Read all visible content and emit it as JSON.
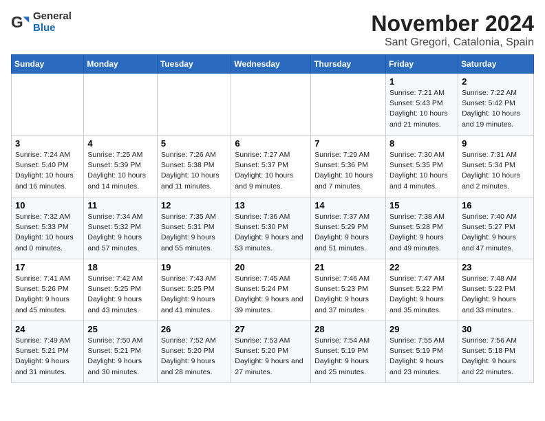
{
  "header": {
    "logo_general": "General",
    "logo_blue": "Blue",
    "month": "November 2024",
    "location": "Sant Gregori, Catalonia, Spain"
  },
  "weekdays": [
    "Sunday",
    "Monday",
    "Tuesday",
    "Wednesday",
    "Thursday",
    "Friday",
    "Saturday"
  ],
  "weeks": [
    [
      {
        "day": "",
        "info": ""
      },
      {
        "day": "",
        "info": ""
      },
      {
        "day": "",
        "info": ""
      },
      {
        "day": "",
        "info": ""
      },
      {
        "day": "",
        "info": ""
      },
      {
        "day": "1",
        "info": "Sunrise: 7:21 AM\nSunset: 5:43 PM\nDaylight: 10 hours and 21 minutes."
      },
      {
        "day": "2",
        "info": "Sunrise: 7:22 AM\nSunset: 5:42 PM\nDaylight: 10 hours and 19 minutes."
      }
    ],
    [
      {
        "day": "3",
        "info": "Sunrise: 7:24 AM\nSunset: 5:40 PM\nDaylight: 10 hours and 16 minutes."
      },
      {
        "day": "4",
        "info": "Sunrise: 7:25 AM\nSunset: 5:39 PM\nDaylight: 10 hours and 14 minutes."
      },
      {
        "day": "5",
        "info": "Sunrise: 7:26 AM\nSunset: 5:38 PM\nDaylight: 10 hours and 11 minutes."
      },
      {
        "day": "6",
        "info": "Sunrise: 7:27 AM\nSunset: 5:37 PM\nDaylight: 10 hours and 9 minutes."
      },
      {
        "day": "7",
        "info": "Sunrise: 7:29 AM\nSunset: 5:36 PM\nDaylight: 10 hours and 7 minutes."
      },
      {
        "day": "8",
        "info": "Sunrise: 7:30 AM\nSunset: 5:35 PM\nDaylight: 10 hours and 4 minutes."
      },
      {
        "day": "9",
        "info": "Sunrise: 7:31 AM\nSunset: 5:34 PM\nDaylight: 10 hours and 2 minutes."
      }
    ],
    [
      {
        "day": "10",
        "info": "Sunrise: 7:32 AM\nSunset: 5:33 PM\nDaylight: 10 hours and 0 minutes."
      },
      {
        "day": "11",
        "info": "Sunrise: 7:34 AM\nSunset: 5:32 PM\nDaylight: 9 hours and 57 minutes."
      },
      {
        "day": "12",
        "info": "Sunrise: 7:35 AM\nSunset: 5:31 PM\nDaylight: 9 hours and 55 minutes."
      },
      {
        "day": "13",
        "info": "Sunrise: 7:36 AM\nSunset: 5:30 PM\nDaylight: 9 hours and 53 minutes."
      },
      {
        "day": "14",
        "info": "Sunrise: 7:37 AM\nSunset: 5:29 PM\nDaylight: 9 hours and 51 minutes."
      },
      {
        "day": "15",
        "info": "Sunrise: 7:38 AM\nSunset: 5:28 PM\nDaylight: 9 hours and 49 minutes."
      },
      {
        "day": "16",
        "info": "Sunrise: 7:40 AM\nSunset: 5:27 PM\nDaylight: 9 hours and 47 minutes."
      }
    ],
    [
      {
        "day": "17",
        "info": "Sunrise: 7:41 AM\nSunset: 5:26 PM\nDaylight: 9 hours and 45 minutes."
      },
      {
        "day": "18",
        "info": "Sunrise: 7:42 AM\nSunset: 5:25 PM\nDaylight: 9 hours and 43 minutes."
      },
      {
        "day": "19",
        "info": "Sunrise: 7:43 AM\nSunset: 5:25 PM\nDaylight: 9 hours and 41 minutes."
      },
      {
        "day": "20",
        "info": "Sunrise: 7:45 AM\nSunset: 5:24 PM\nDaylight: 9 hours and 39 minutes."
      },
      {
        "day": "21",
        "info": "Sunrise: 7:46 AM\nSunset: 5:23 PM\nDaylight: 9 hours and 37 minutes."
      },
      {
        "day": "22",
        "info": "Sunrise: 7:47 AM\nSunset: 5:22 PM\nDaylight: 9 hours and 35 minutes."
      },
      {
        "day": "23",
        "info": "Sunrise: 7:48 AM\nSunset: 5:22 PM\nDaylight: 9 hours and 33 minutes."
      }
    ],
    [
      {
        "day": "24",
        "info": "Sunrise: 7:49 AM\nSunset: 5:21 PM\nDaylight: 9 hours and 31 minutes."
      },
      {
        "day": "25",
        "info": "Sunrise: 7:50 AM\nSunset: 5:21 PM\nDaylight: 9 hours and 30 minutes."
      },
      {
        "day": "26",
        "info": "Sunrise: 7:52 AM\nSunset: 5:20 PM\nDaylight: 9 hours and 28 minutes."
      },
      {
        "day": "27",
        "info": "Sunrise: 7:53 AM\nSunset: 5:20 PM\nDaylight: 9 hours and 27 minutes."
      },
      {
        "day": "28",
        "info": "Sunrise: 7:54 AM\nSunset: 5:19 PM\nDaylight: 9 hours and 25 minutes."
      },
      {
        "day": "29",
        "info": "Sunrise: 7:55 AM\nSunset: 5:19 PM\nDaylight: 9 hours and 23 minutes."
      },
      {
        "day": "30",
        "info": "Sunrise: 7:56 AM\nSunset: 5:18 PM\nDaylight: 9 hours and 22 minutes."
      }
    ]
  ]
}
